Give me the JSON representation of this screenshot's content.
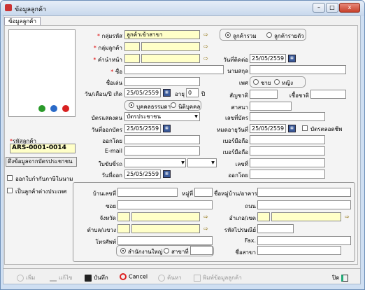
{
  "window": {
    "title": "ข้อมูลลูกค้า",
    "min": "–",
    "max": "□",
    "close": "x"
  },
  "tab": "ข้อมูลลูกค้า",
  "customer_id": {
    "label": "รหัสลูกค้า",
    "value": "ARS-0001-0014"
  },
  "idcard_button": "ดึงข้อมูลจากบัตรประชาชน",
  "check_staff": "ออกใบกำกับภาษีในนาม",
  "check_foreign": "เป็นลูกค้าต่างประเทศ",
  "form": {
    "group_code_label": "กลุ่มรหัส",
    "group_code_value": "ลูกค้าเข้าสาขา",
    "customer_group_label": "กลุ่มลูกค้า",
    "prefix_label": "คำนำหน้า",
    "name_label": "ชื่อ",
    "surname_label": "นามสกุล",
    "nickname_label": "ชื่อเล่น",
    "gender_label": "เพศ",
    "male": "ชาย",
    "female": "หญิง",
    "birth_label": "วัน/เดือน/ปี เกิด",
    "birth_value": "25/05/2559",
    "age_label": "อายุ",
    "age_value": "0",
    "age_unit": "ปี",
    "nationality_label": "สัญชาติ",
    "race_label": "เชื้อชาติ",
    "religion_label": "ศาสนา",
    "person_type": "บุคคลธรรมดา",
    "juristic": "นิติบุคคล",
    "card_label": "บัตรแสดงตน",
    "card_value": "บัตรประชาชน",
    "card_no_label": "เลขที่บัตร",
    "issue_label": "วันที่ออกบัตร",
    "issue_value": "25/05/2559",
    "expire_label": "หมดอายุวันที่",
    "expire_value": "25/05/2559",
    "credit_label": "บัตรตลอดชีพ",
    "issued_by_label": "ออกโดย",
    "mobile1_label": "เบอร์มือถือ",
    "email_label": "E-mail",
    "mobile2_label": "เบอร์มือถือ",
    "contact_label": "วันที่ติดต่อ",
    "contact_value": "25/05/2559",
    "cert_label": "ใบขับขี่รถ",
    "cert_no_label": "เลขที่",
    "cert_issue_label": "วันที่ออก",
    "cert_issue_value": "25/05/2559",
    "cert_by_label": "ออกโดย",
    "all_customers": "ลูกค้ารวม",
    "single_customer": "ลูกค้ารายตัว"
  },
  "address": {
    "house_label": "บ้านเลขที่",
    "moo_label": "หมู่ที่",
    "village_label": "ชื่อหมู่บ้าน/อาคาร",
    "soi_label": "ซอย",
    "road_label": "ถนน",
    "province_label": "จังหวัด",
    "district_label": "อำเภอ/เขต",
    "subdistrict_label": "ตำบล/แขวง",
    "postcode_label": "รหัสไปรษณีย์",
    "phone_label": "โทรศัพท์",
    "fax_label": "Fax.",
    "hq": "สำนักงานใหญ่",
    "branch": "สาขาที่",
    "branch_name_label": "ชื่อสาขา"
  },
  "toolbar": {
    "add": "เพิ่ม",
    "edit": "แก้ไข",
    "save": "บันทึก",
    "cancel": "Cancel",
    "search": "ค้นหา",
    "print": "พิมพ์ข้อมูลลูกค้า",
    "close": "ปิด"
  },
  "colors": {
    "required": "#d00000",
    "yellow_field": "#ffffc8"
  }
}
